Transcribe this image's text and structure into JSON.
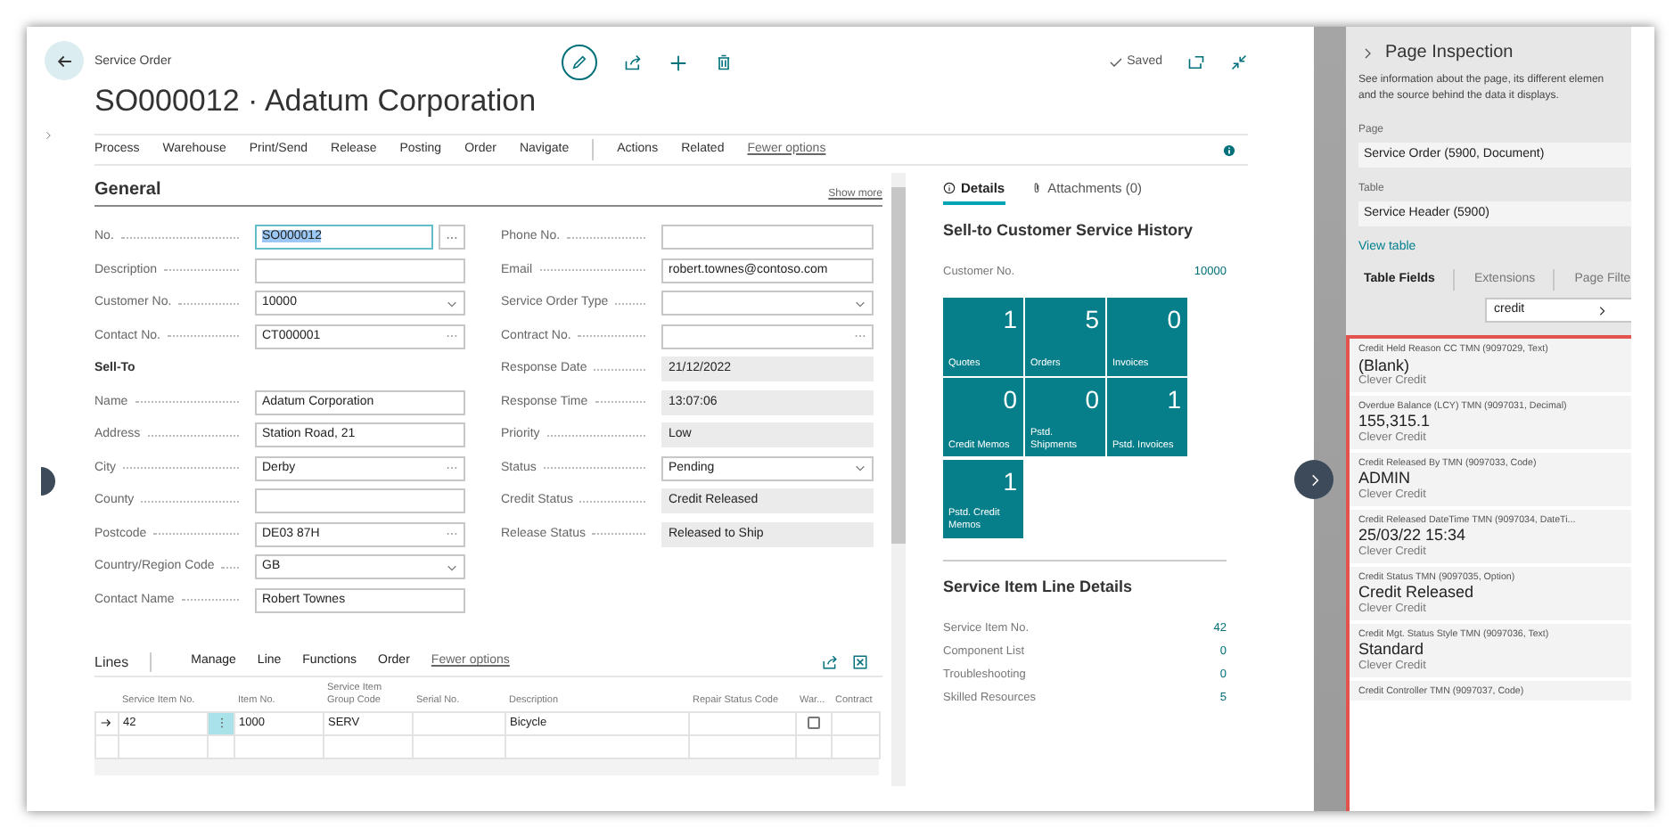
{
  "header": {
    "breadcrumb": "Service Order",
    "title": "SO000012 · Adatum Corporation",
    "save_status": "Saved"
  },
  "action_bar": {
    "groups": [
      [
        "Process",
        "Warehouse",
        "Print/Send",
        "Release",
        "Posting",
        "Order",
        "Navigate"
      ],
      [
        "Actions",
        "Related"
      ]
    ],
    "more": "Fewer options"
  },
  "general": {
    "title": "General",
    "more": "Show more",
    "left": [
      {
        "label": "No.",
        "value": "SO000012",
        "kind": "assist"
      },
      {
        "label": "Description",
        "kind": "text"
      },
      {
        "label": "Customer No.",
        "value": "10000",
        "kind": "dropdown"
      },
      {
        "label": "Contact No.",
        "value": "CT000001",
        "kind": "lookup"
      },
      {
        "label": "Sell-To",
        "kind": "heading"
      },
      {
        "label": "Name",
        "value": "Adatum Corporation",
        "kind": "text"
      },
      {
        "label": "Address",
        "value": "Station Road, 21",
        "kind": "text"
      },
      {
        "label": "City",
        "value": "Derby",
        "kind": "lookup"
      },
      {
        "label": "County",
        "kind": "text"
      },
      {
        "label": "Postcode",
        "value": "DE03 87H",
        "kind": "lookup"
      },
      {
        "label": "Country/Region Code",
        "value": "GB",
        "kind": "dropdown"
      },
      {
        "label": "Contact Name",
        "value": "Robert Townes",
        "kind": "text"
      }
    ],
    "right": [
      {
        "label": "Phone No.",
        "kind": "text"
      },
      {
        "label": "Email",
        "value": "robert.townes@contoso.com",
        "kind": "text"
      },
      {
        "label": "Service Order Type",
        "kind": "dropdown"
      },
      {
        "label": "Contract No.",
        "kind": "lookup"
      },
      {
        "label": "Response Date",
        "value": "21/12/2022",
        "kind": "readonly"
      },
      {
        "label": "Response Time",
        "value": "13:07:06",
        "kind": "readonly"
      },
      {
        "label": "Priority",
        "value": "Low",
        "kind": "readonly"
      },
      {
        "label": "Status",
        "value": "Pending",
        "kind": "dropdown"
      },
      {
        "label": "Credit Status",
        "value": "Credit Released",
        "kind": "readonly"
      },
      {
        "label": "Release Status",
        "value": "Released to Ship",
        "kind": "readonly"
      }
    ]
  },
  "lines": {
    "title": "Lines",
    "actions": [
      "Manage",
      "Line",
      "Functions",
      "Order"
    ],
    "more": "Fewer options",
    "columns": [
      "Service Item No.",
      "Item No.",
      "Service Item Group Code",
      "Serial No.",
      "Description",
      "Repair Status Code",
      "War...",
      "Contract"
    ],
    "rows": [
      {
        "selected": true,
        "service_item_no": "42",
        "item_no": "1000",
        "group_code": "SERV",
        "description": "Bicycle",
        "warranty": false
      },
      {
        "selected": false
      }
    ]
  },
  "factbox": {
    "tabs": [
      {
        "label": "Details",
        "selected": true
      },
      {
        "label": "Attachments (0)",
        "selected": false
      }
    ],
    "history": {
      "title": "Sell-to Customer Service History",
      "customer_label": "Customer No.",
      "customer_value": "10000",
      "tiles": [
        {
          "value": "1",
          "label": "Quotes"
        },
        {
          "value": "5",
          "label": "Orders"
        },
        {
          "value": "0",
          "label": "Invoices"
        },
        {
          "value": "0",
          "label": "Credit Memos"
        },
        {
          "value": "0",
          "label": "Pstd. Shipments"
        },
        {
          "value": "1",
          "label": "Pstd. Invoices"
        },
        {
          "value": "1",
          "label": "Pstd. Credit Memos"
        }
      ]
    },
    "line_details": {
      "title": "Service Item Line Details",
      "rows": [
        {
          "label": "Service Item No.",
          "value": "42"
        },
        {
          "label": "Component List",
          "value": "0"
        },
        {
          "label": "Troubleshooting",
          "value": "0"
        },
        {
          "label": "Skilled Resources",
          "value": "5"
        }
      ]
    }
  },
  "inspection": {
    "title": "Page Inspection",
    "description_lines": [
      "See information about the page, its different elemen",
      "and the source behind the data it displays."
    ],
    "page_label": "Page",
    "page_value": "Service Order (5900, Document)",
    "table_label": "Table",
    "table_value": "Service Header (5900)",
    "link": "View table",
    "tabs": [
      {
        "label": "Table Fields",
        "selected": true
      },
      {
        "label": "Extensions",
        "selected": false
      },
      {
        "label": "Page Filte",
        "selected": false
      }
    ],
    "search": "credit",
    "fields": [
      {
        "caption": "Credit Held Reason CC TMN (9097029, Text)",
        "value": "(Blank)",
        "source": "Clever Credit"
      },
      {
        "caption": "Overdue Balance (LCY) TMN (9097031, Decimal)",
        "value": "155,315.1",
        "source": "Clever Credit"
      },
      {
        "caption": "Credit Released By TMN (9097033, Code)",
        "value": "ADMIN",
        "source": "Clever Credit"
      },
      {
        "caption": "Credit Released DateTime TMN (9097034, DateTi...",
        "value": "25/03/22 15:34",
        "source": "Clever Credit"
      },
      {
        "caption": "Credit Status TMN (9097035, Option)",
        "value": "Credit Released",
        "source": "Clever Credit"
      },
      {
        "caption": "Credit Mgt. Status Style TMN (9097036, Text)",
        "value": "Standard",
        "source": "Clever Credit"
      },
      {
        "caption": "Credit Controller TMN (9097037, Code)"
      }
    ]
  }
}
